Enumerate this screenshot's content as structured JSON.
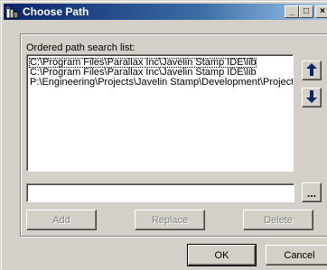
{
  "window": {
    "title": "Choose Path",
    "minimize_glyph": "_",
    "maximize_glyph": "□",
    "close_glyph": "×"
  },
  "list": {
    "label": "Ordered path search list:",
    "items": [
      "C:\\Program Files\\Parallax Inc\\Javelin Stamp IDE\\lib",
      "C:\\Program Files\\Parallax Inc\\Javelin Stamp IDE\\lib",
      "P:\\Engineering\\Projects\\Javelin Stamp\\Development\\Project"
    ],
    "selected_index": 0
  },
  "move_buttons": {
    "up_icon": "arrow-up-icon",
    "down_icon": "arrow-down-icon"
  },
  "path_field": {
    "value": "",
    "placeholder": ""
  },
  "browse_button": {
    "label": "..."
  },
  "actions": {
    "add_label": "Add",
    "replace_label": "Replace",
    "delete_label": "Delete"
  },
  "dialog_buttons": {
    "ok_label": "OK",
    "cancel_label": "Cancel"
  },
  "colors": {
    "face": "#d4d0c8",
    "title_start": "#0a246a",
    "title_end": "#a6caf0",
    "arrow": "#0a246a"
  }
}
